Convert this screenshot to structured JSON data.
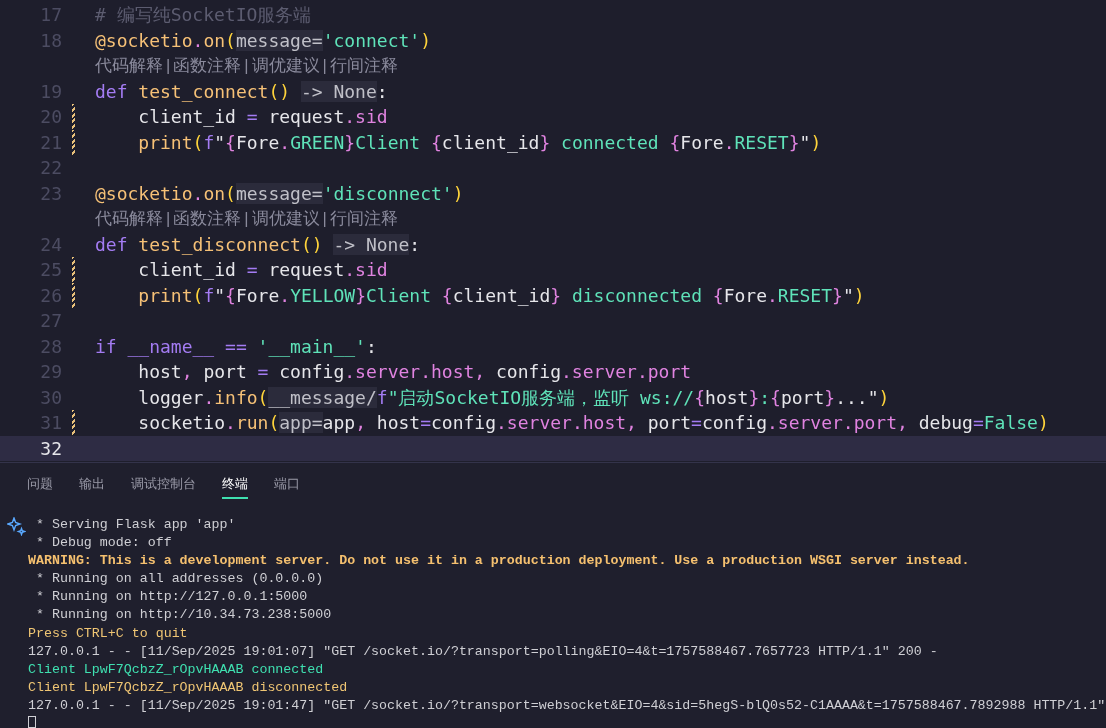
{
  "editor": {
    "rows": [
      {
        "kind": "code",
        "n": "17",
        "modified": false,
        "current": false,
        "tokens": [
          {
            "kind": "comment",
            "text": "# 编写纯SocketIO服务端"
          }
        ]
      },
      {
        "kind": "code",
        "n": "18",
        "modified": false,
        "current": false,
        "tokens": [
          {
            "kind": "func",
            "text": "@socketio"
          },
          {
            "kind": "punct",
            "text": "."
          },
          {
            "kind": "func",
            "text": "on"
          },
          {
            "kind": "paren",
            "text": "("
          },
          {
            "kind": "hint",
            "text": "message="
          },
          {
            "kind": "string",
            "text": "'connect'"
          },
          {
            "kind": "paren",
            "text": ")"
          }
        ]
      },
      {
        "kind": "lens",
        "separator": "|",
        "items": [
          "代码解释",
          "函数注释",
          "调优建议",
          "行间注释"
        ]
      },
      {
        "kind": "code",
        "n": "19",
        "modified": false,
        "current": false,
        "tokens": [
          {
            "kind": "keyword",
            "text": "def "
          },
          {
            "kind": "func",
            "text": "test_connect"
          },
          {
            "kind": "paren",
            "text": "() "
          },
          {
            "kind": "hint",
            "text": "-> None"
          },
          {
            "kind": "plain",
            "text": ":"
          }
        ]
      },
      {
        "kind": "code",
        "n": "20",
        "modified": true,
        "current": false,
        "tokens": [
          {
            "kind": "plain",
            "text": "    client_id "
          },
          {
            "kind": "keyword",
            "text": "="
          },
          {
            "kind": "plain",
            "text": " request"
          },
          {
            "kind": "punct",
            "text": ".sid"
          }
        ]
      },
      {
        "kind": "code",
        "n": "21",
        "modified": true,
        "current": false,
        "tokens": [
          {
            "kind": "func",
            "text": "    print"
          },
          {
            "kind": "paren",
            "text": "("
          },
          {
            "kind": "keyword",
            "text": "f"
          },
          {
            "kind": "plain",
            "text": "\""
          },
          {
            "kind": "punct",
            "text": "{"
          },
          {
            "kind": "plain",
            "text": "Fore"
          },
          {
            "kind": "punct",
            "text": "."
          },
          {
            "kind": "string",
            "text": "GREEN"
          },
          {
            "kind": "punct",
            "text": "}"
          },
          {
            "kind": "string",
            "text": "Client "
          },
          {
            "kind": "punct",
            "text": "{"
          },
          {
            "kind": "plain",
            "text": "client_id"
          },
          {
            "kind": "punct",
            "text": "}"
          },
          {
            "kind": "string",
            "text": " connected "
          },
          {
            "kind": "punct",
            "text": "{"
          },
          {
            "kind": "plain",
            "text": "Fore"
          },
          {
            "kind": "punct",
            "text": "."
          },
          {
            "kind": "string",
            "text": "RESET"
          },
          {
            "kind": "punct",
            "text": "}"
          },
          {
            "kind": "plain",
            "text": "\""
          },
          {
            "kind": "paren",
            "text": ")"
          }
        ]
      },
      {
        "kind": "code",
        "n": "22",
        "modified": false,
        "current": false,
        "tokens": []
      },
      {
        "kind": "code",
        "n": "23",
        "modified": false,
        "current": false,
        "tokens": [
          {
            "kind": "func",
            "text": "@socketio"
          },
          {
            "kind": "punct",
            "text": "."
          },
          {
            "kind": "func",
            "text": "on"
          },
          {
            "kind": "paren",
            "text": "("
          },
          {
            "kind": "hint",
            "text": "message="
          },
          {
            "kind": "string",
            "text": "'disconnect'"
          },
          {
            "kind": "paren",
            "text": ")"
          }
        ]
      },
      {
        "kind": "lens",
        "separator": "|",
        "items": [
          "代码解释",
          "函数注释",
          "调优建议",
          "行间注释"
        ]
      },
      {
        "kind": "code",
        "n": "24",
        "modified": false,
        "current": false,
        "tokens": [
          {
            "kind": "keyword",
            "text": "def "
          },
          {
            "kind": "func",
            "text": "test_disconnect"
          },
          {
            "kind": "paren",
            "text": "() "
          },
          {
            "kind": "hint",
            "text": "-> None"
          },
          {
            "kind": "plain",
            "text": ":"
          }
        ]
      },
      {
        "kind": "code",
        "n": "25",
        "modified": true,
        "current": false,
        "tokens": [
          {
            "kind": "plain",
            "text": "    client_id "
          },
          {
            "kind": "keyword",
            "text": "="
          },
          {
            "kind": "plain",
            "text": " request"
          },
          {
            "kind": "punct",
            "text": ".sid"
          }
        ]
      },
      {
        "kind": "code",
        "n": "26",
        "modified": true,
        "current": false,
        "tokens": [
          {
            "kind": "func",
            "text": "    print"
          },
          {
            "kind": "paren",
            "text": "("
          },
          {
            "kind": "keyword",
            "text": "f"
          },
          {
            "kind": "plain",
            "text": "\""
          },
          {
            "kind": "punct",
            "text": "{"
          },
          {
            "kind": "plain",
            "text": "Fore"
          },
          {
            "kind": "punct",
            "text": "."
          },
          {
            "kind": "string",
            "text": "YELLOW"
          },
          {
            "kind": "punct",
            "text": "}"
          },
          {
            "kind": "string",
            "text": "Client "
          },
          {
            "kind": "punct",
            "text": "{"
          },
          {
            "kind": "plain",
            "text": "client_id"
          },
          {
            "kind": "punct",
            "text": "}"
          },
          {
            "kind": "string",
            "text": " disconnected "
          },
          {
            "kind": "punct",
            "text": "{"
          },
          {
            "kind": "plain",
            "text": "Fore"
          },
          {
            "kind": "punct",
            "text": "."
          },
          {
            "kind": "string",
            "text": "RESET"
          },
          {
            "kind": "punct",
            "text": "}"
          },
          {
            "kind": "plain",
            "text": "\""
          },
          {
            "kind": "paren",
            "text": ")"
          }
        ]
      },
      {
        "kind": "code",
        "n": "27",
        "modified": false,
        "current": false,
        "tokens": []
      },
      {
        "kind": "code",
        "n": "28",
        "modified": false,
        "current": false,
        "tokens": [
          {
            "kind": "keyword",
            "text": "if __name__ == "
          },
          {
            "kind": "string",
            "text": "'__main__'"
          },
          {
            "kind": "plain",
            "text": ":"
          }
        ]
      },
      {
        "kind": "code",
        "n": "29",
        "modified": false,
        "current": false,
        "tokens": [
          {
            "kind": "plain",
            "text": "    host"
          },
          {
            "kind": "punct",
            "text": ","
          },
          {
            "kind": "plain",
            "text": " port "
          },
          {
            "kind": "keyword",
            "text": "="
          },
          {
            "kind": "plain",
            "text": " config"
          },
          {
            "kind": "punct",
            "text": ".server.host,"
          },
          {
            "kind": "plain",
            "text": " config"
          },
          {
            "kind": "punct",
            "text": ".server.port"
          }
        ]
      },
      {
        "kind": "code",
        "n": "30",
        "modified": false,
        "current": false,
        "tokens": [
          {
            "kind": "plain",
            "text": "    logger"
          },
          {
            "kind": "punct",
            "text": "."
          },
          {
            "kind": "func",
            "text": "info"
          },
          {
            "kind": "paren",
            "text": "("
          },
          {
            "kind": "hint",
            "text": "__message/"
          },
          {
            "kind": "keyword",
            "text": "f"
          },
          {
            "kind": "string",
            "text": "\"启动SocketIO服务端，监听 ws://"
          },
          {
            "kind": "punct",
            "text": "{"
          },
          {
            "kind": "plain",
            "text": "host"
          },
          {
            "kind": "punct",
            "text": "}"
          },
          {
            "kind": "string",
            "text": ":"
          },
          {
            "kind": "punct",
            "text": "{"
          },
          {
            "kind": "plain",
            "text": "port"
          },
          {
            "kind": "punct",
            "text": "}"
          },
          {
            "kind": "plain",
            "text": "...\""
          },
          {
            "kind": "paren",
            "text": ")"
          }
        ]
      },
      {
        "kind": "code",
        "n": "31",
        "modified": true,
        "current": false,
        "tokens": [
          {
            "kind": "plain",
            "text": "    socketio"
          },
          {
            "kind": "punct",
            "text": "."
          },
          {
            "kind": "func",
            "text": "run"
          },
          {
            "kind": "paren",
            "text": "("
          },
          {
            "kind": "hint",
            "text": "app="
          },
          {
            "kind": "plain",
            "text": "app"
          },
          {
            "kind": "punct",
            "text": ","
          },
          {
            "kind": "plain",
            "text": " host"
          },
          {
            "kind": "keyword",
            "text": "="
          },
          {
            "kind": "plain",
            "text": "config"
          },
          {
            "kind": "punct",
            "text": ".server.host,"
          },
          {
            "kind": "plain",
            "text": " port"
          },
          {
            "kind": "keyword",
            "text": "="
          },
          {
            "kind": "plain",
            "text": "config"
          },
          {
            "kind": "punct",
            "text": ".server.port,"
          },
          {
            "kind": "plain",
            "text": " debug"
          },
          {
            "kind": "keyword",
            "text": "="
          },
          {
            "kind": "string",
            "text": "False"
          },
          {
            "kind": "paren",
            "text": ")"
          }
        ]
      },
      {
        "kind": "code",
        "n": "32",
        "modified": false,
        "current": true,
        "tokens": []
      }
    ]
  },
  "panel": {
    "tabs": [
      {
        "label": "问题",
        "selected": false
      },
      {
        "label": "输出",
        "selected": false
      },
      {
        "label": "调试控制台",
        "selected": false
      },
      {
        "label": "终端",
        "selected": true
      },
      {
        "label": "端口",
        "selected": false
      }
    ],
    "terminal": [
      {
        "kind": "normal",
        "text": " * Serving Flask app 'app'"
      },
      {
        "kind": "normal",
        "text": " * Debug mode: off"
      },
      {
        "kind": "warning",
        "text": "WARNING: This is a development server. Do not use it in a production deployment. Use a production WSGI server instead."
      },
      {
        "kind": "normal",
        "text": " * Running on all addresses (0.0.0.0)"
      },
      {
        "kind": "normal",
        "text": " * Running on http://127.0.0.1:5000"
      },
      {
        "kind": "normal",
        "text": " * Running on http://10.34.73.238:5000"
      },
      {
        "kind": "yellow",
        "text": "Press CTRL+C to quit"
      },
      {
        "kind": "normal",
        "text": "127.0.0.1 - - [11/Sep/2025 19:01:07] \"GET /socket.io/?transport=polling&EIO=4&t=1757588467.7657723 HTTP/1.1\" 200 -"
      },
      {
        "kind": "green",
        "text": "Client LpwF7QcbzZ_rOpvHAAAB connected"
      },
      {
        "kind": "yellow",
        "text": "Client LpwF7QcbzZ_rOpvHAAAB disconnected"
      },
      {
        "kind": "normal",
        "text": "127.0.0.1 - - [11/Sep/2025 19:01:47] \"GET /socket.io/?transport=websocket&EIO=4&sid=5hegS-blQ0s52-C1AAAA&t=1757588467.7892988 HTTP/1.1\""
      }
    ]
  }
}
